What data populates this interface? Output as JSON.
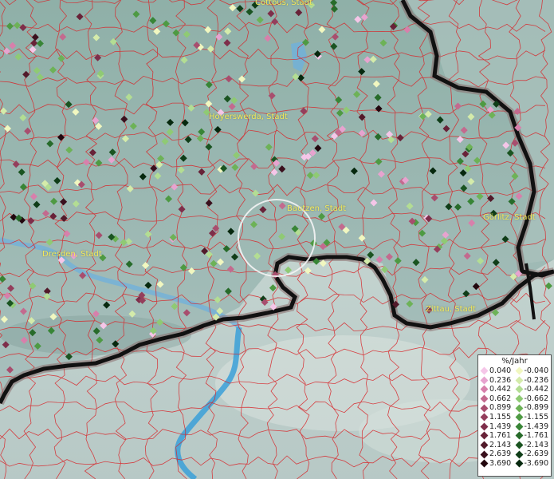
{
  "map": {
    "cities": [
      {
        "id": "cottbus",
        "name": "Cottbus, Stadt"
      },
      {
        "id": "hoyerswerda",
        "name": "Hoyerswerda, Stadt"
      },
      {
        "id": "bautzen",
        "name": "Bautzen, Stadt"
      },
      {
        "id": "goerlitz",
        "name": "Görlitz, Stadt"
      },
      {
        "id": "dresden",
        "name": "Dresden, Stadt"
      },
      {
        "id": "zittau",
        "name": "Zittau, Stadt"
      }
    ]
  },
  "legend": {
    "title": "%/Jahr",
    "positive": [
      {
        "label": "0.040",
        "color": "#f5c6e8"
      },
      {
        "label": "0.236",
        "color": "#e7a3cf"
      },
      {
        "label": "0.442",
        "color": "#d780ab"
      },
      {
        "label": "0.662",
        "color": "#c36a8e"
      },
      {
        "label": "0.899",
        "color": "#a84e6e"
      },
      {
        "label": "1.155",
        "color": "#943e5c"
      },
      {
        "label": "1.439",
        "color": "#7e2e4a"
      },
      {
        "label": "1.761",
        "color": "#682238"
      },
      {
        "label": "2.143",
        "color": "#521a2a"
      },
      {
        "label": "2.639",
        "color": "#3a101d"
      },
      {
        "label": "3.690",
        "color": "#22070e"
      }
    ],
    "negative": [
      {
        "label": "-0.040",
        "color": "#f1f7c0"
      },
      {
        "label": "-0.236",
        "color": "#d4ebaa"
      },
      {
        "label": "-0.442",
        "color": "#b3dd93"
      },
      {
        "label": "-0.662",
        "color": "#8fca74"
      },
      {
        "label": "-0.899",
        "color": "#6db257"
      },
      {
        "label": "-1.155",
        "color": "#4e9a43"
      },
      {
        "label": "-1.439",
        "color": "#388536"
      },
      {
        "label": "-1.761",
        "color": "#276b2a"
      },
      {
        "label": "-2.143",
        "color": "#1a5421"
      },
      {
        "label": "-2.639",
        "color": "#0f3d18"
      },
      {
        "label": "-3.690",
        "color": "#06280e"
      }
    ]
  }
}
